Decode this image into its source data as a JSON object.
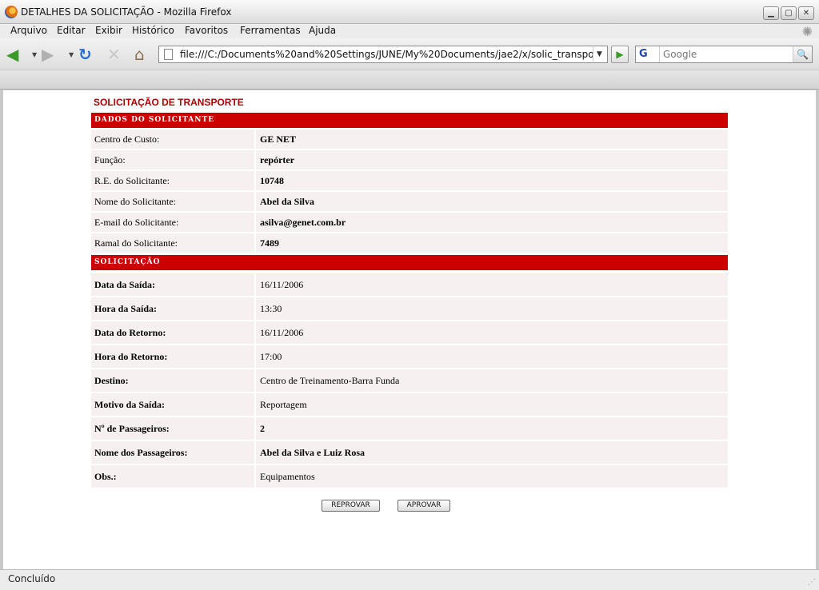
{
  "window": {
    "title": "DETALHES DA SOLICITAÇÃO - Mozilla Firefox",
    "controls": {
      "minimize": "▁",
      "maximize": "▢",
      "close": "✕"
    }
  },
  "menu": [
    "Arquivo",
    "Editar",
    "Exibir",
    "Histórico",
    "Favoritos",
    "Ferramentas",
    "Ajuda"
  ],
  "nav": {
    "url": "file:///C:/Documents%20and%20Settings/JUNE/My%20Documents/jae2/x/solic_transportes_p",
    "search_placeholder": "Google",
    "search_engine_letter": "G",
    "icons": {
      "back": "◀",
      "forward": "▶",
      "reload": "↻",
      "stop": "✕",
      "home": "⌂",
      "go": "▶",
      "search": "🔍"
    }
  },
  "page": {
    "title": "SOLICITAÇÃO DE TRANSPORTE",
    "section1": {
      "header": "DADOS DO SOLICITANTE",
      "rows": [
        {
          "label": "Centro de Custo:",
          "value": "GE NET"
        },
        {
          "label": "Função:",
          "value": "repórter"
        },
        {
          "label": "R.E. do Solicitante:",
          "value": "10748"
        },
        {
          "label": "Nome do Solicitante:",
          "value": "Abel da Silva"
        },
        {
          "label": "E-mail do Solicitante:",
          "value": "asilva@genet.com.br"
        },
        {
          "label": "Ramal do Solicitante:",
          "value": "7489"
        }
      ]
    },
    "section2": {
      "header": "SOLICITAÇÃO",
      "rows": [
        {
          "label": "Data da Saída:",
          "value": "16/11/2006"
        },
        {
          "label": "Hora da Saída:",
          "value": "13:30"
        },
        {
          "label": "Data do Retorno:",
          "value": "16/11/2006"
        },
        {
          "label": "Hora do Retorno:",
          "value": "17:00"
        },
        {
          "label": "Destino:",
          "value": "Centro de Treinamento-Barra Funda"
        },
        {
          "label": "Motivo da Saída:",
          "value": "Reportagem"
        },
        {
          "label": "Nº de Passageiros:",
          "value": "2"
        },
        {
          "label": "Nome dos Passageiros:",
          "value": "Abel da Silva e Luiz Rosa"
        },
        {
          "label": "Obs.:",
          "value": "Equipamentos"
        }
      ]
    },
    "buttons": {
      "reject": "REPROVAR",
      "approve": "APROVAR"
    }
  },
  "status": "Concluído"
}
